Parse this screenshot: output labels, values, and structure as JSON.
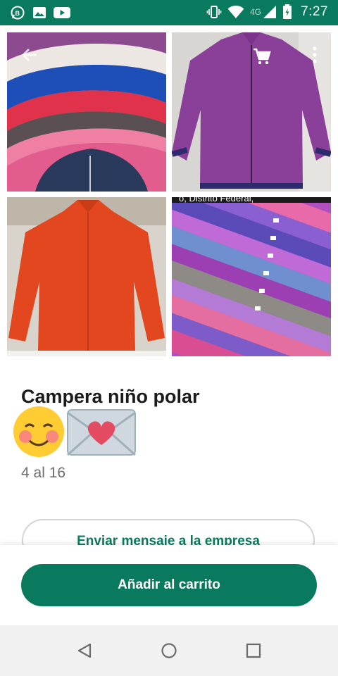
{
  "status_bar": {
    "network_type": "4G",
    "time": "7:27",
    "icons": [
      "whatsapp-business-icon",
      "image-icon",
      "youtube-icon",
      "vibrate-icon",
      "wifi-icon",
      "signal-icon",
      "battery-icon"
    ]
  },
  "gallery": {
    "images": [
      {
        "name": "stacked fleece jackets"
      },
      {
        "name": "purple fleece jacket"
      },
      {
        "name": "orange fleece jacket"
      },
      {
        "name": "folded colorful fleece jackets"
      }
    ],
    "overlay_caption": "o, Distrito Federal,"
  },
  "toolbar": {
    "back_icon": "arrow-back-icon",
    "cart_icon": "shopping-cart-icon",
    "menu_icon": "more-vert-icon"
  },
  "product": {
    "title": "Campera niño polar",
    "emojis": [
      "smiling-face-emoji",
      "love-letter-emoji"
    ],
    "description": "4 al 16"
  },
  "actions": {
    "message_label": "Enviar mensaje a la empresa",
    "add_to_cart_label": "Añadir al carrito"
  },
  "colors": {
    "accent": "#0a7a5e",
    "title_text": "#1b1b1b",
    "secondary_text": "#6e6e6e"
  }
}
